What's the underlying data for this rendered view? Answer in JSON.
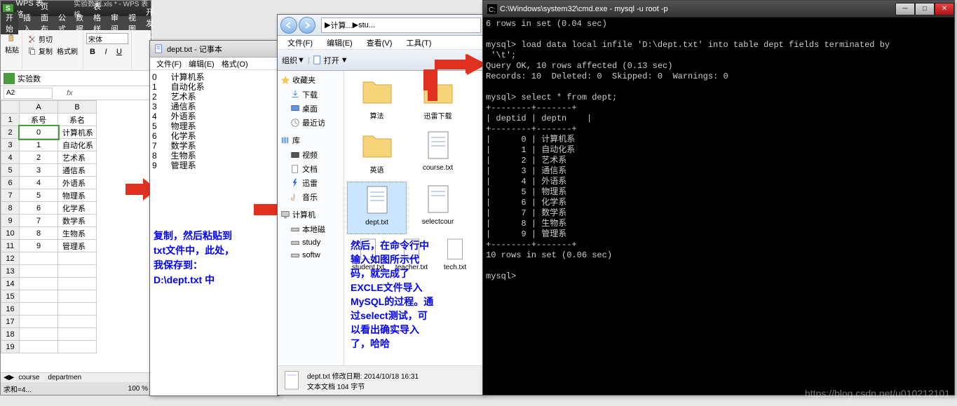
{
  "wps": {
    "app_name": "WPS 表格",
    "file_name": "实验数据.xls * - WPS 表格",
    "menu": {
      "start": "开始",
      "insert": "插入",
      "layout": "页面布局",
      "formula": "公式",
      "data": "数据",
      "style": "表格样式",
      "review": "审阅",
      "view": "视图",
      "dev": "开发工"
    },
    "tool": {
      "cut": "剪切",
      "copy": "复制",
      "brush": "格式刷",
      "paste": "粘贴",
      "font": "宋体"
    },
    "fmt": {
      "bold": "B",
      "italic": "I",
      "under": "U"
    },
    "tab": "实验数",
    "cell_ref": "A2",
    "fx": "fx",
    "cols": {
      "A": "A",
      "B": "B"
    },
    "headers": {
      "a": "系号",
      "b": "系名"
    },
    "rows": [
      {
        "n": "0",
        "t": "计算机系"
      },
      {
        "n": "1",
        "t": "自动化系"
      },
      {
        "n": "2",
        "t": "艺术系"
      },
      {
        "n": "3",
        "t": "通信系"
      },
      {
        "n": "4",
        "t": "外语系"
      },
      {
        "n": "5",
        "t": "物理系"
      },
      {
        "n": "6",
        "t": "化学系"
      },
      {
        "n": "7",
        "t": "数学系"
      },
      {
        "n": "8",
        "t": "生物系"
      },
      {
        "n": "9",
        "t": "管理系"
      }
    ],
    "sheets": {
      "course": "course",
      "dept": "departmen"
    },
    "status": {
      "sum": "求和=4...",
      "zoom": "100 %"
    }
  },
  "notepad": {
    "title": "dept.txt - 记事本",
    "menu": {
      "file": "文件(F)",
      "edit": "编辑(E)",
      "format": "格式(O)"
    },
    "lines": [
      "0\t计算机系",
      "1\t自动化系",
      "2\t艺术系",
      "3\t通信系",
      "4\t外语系",
      "5\t物理系",
      "6\t化学系",
      "7\t数学系",
      "8\t生物系",
      "9\t管理系"
    ],
    "annotation": {
      "l1": "复制，然后粘贴到",
      "l2": "txt文件中，此处，",
      "l3": "我保存到：",
      "l4": "D:\\dept.txt 中"
    }
  },
  "explorer": {
    "breadcrumb": {
      "p1": "计算...",
      "p2": "stu...",
      "sep": "▶"
    },
    "menu": {
      "file": "文件(F)",
      "edit": "编辑(E)",
      "view": "查看(V)",
      "tool": "工具(T)"
    },
    "tb": {
      "org": "组织",
      "open": "打开",
      "sep": "▼"
    },
    "side": {
      "fav": "收藏夹",
      "dl": "下载",
      "desk": "桌面",
      "recent": "最近访",
      "lib": "库",
      "video": "视频",
      "doc": "文档",
      "thunder": "迅雷",
      "music": "音乐",
      "comp": "计算机",
      "local": "本地磁",
      "study": "study",
      "soft": "softw"
    },
    "files": {
      "folder1": "算法",
      "folder2": "迅雷下载",
      "folder3": "英语",
      "course": "course.txt",
      "selcourse": "selectcour",
      "dept": "dept.txt",
      "student": "student.txt",
      "teacher": "teacher.txt",
      "tech": "tech.txt"
    },
    "status": {
      "name": "dept.txt",
      "mod": "修改日期: 2014/10/18 16:31",
      "type": "文本文档",
      "size": "104 字节"
    },
    "annotation": {
      "l1": "然后，在命令行中",
      "l2": "输入如图所示代",
      "l3": "码，就完成了",
      "l4": "EXCLE文件导入",
      "l5": "MySQL的过程。通",
      "l6": "过select测试，可",
      "l7": "以看出确实导入",
      "l8": "了，哈哈"
    }
  },
  "cmd": {
    "title": "C:\\Windows\\system32\\cmd.exe - mysql  -u root -p",
    "lines": [
      "6 rows in set (0.04 sec)",
      "",
      "mysql> load data local infile 'D:\\dept.txt' into table dept fields terminated by",
      " '\\t';",
      "Query OK, 10 rows affected (0.13 sec)",
      "Records: 10  Deleted: 0  Skipped: 0  Warnings: 0",
      "",
      "mysql> select * from dept;",
      "+--------+-------+",
      "| deptid | deptn    |",
      "+--------+-------+",
      "|      0 | 计算机系",
      "|      1 | 自动化系",
      "|      2 | 艺术系",
      "|      3 | 通信系",
      "|      4 | 外语系",
      "|      5 | 物理系",
      "|      6 | 化学系",
      "|      7 | 数学系",
      "|      8 | 生物系",
      "|      9 | 管理系",
      "+--------+-------+",
      "10 rows in set (0.06 sec)",
      "",
      "mysql>"
    ]
  },
  "watermark": "https://blog.csdn.net/u010212101"
}
